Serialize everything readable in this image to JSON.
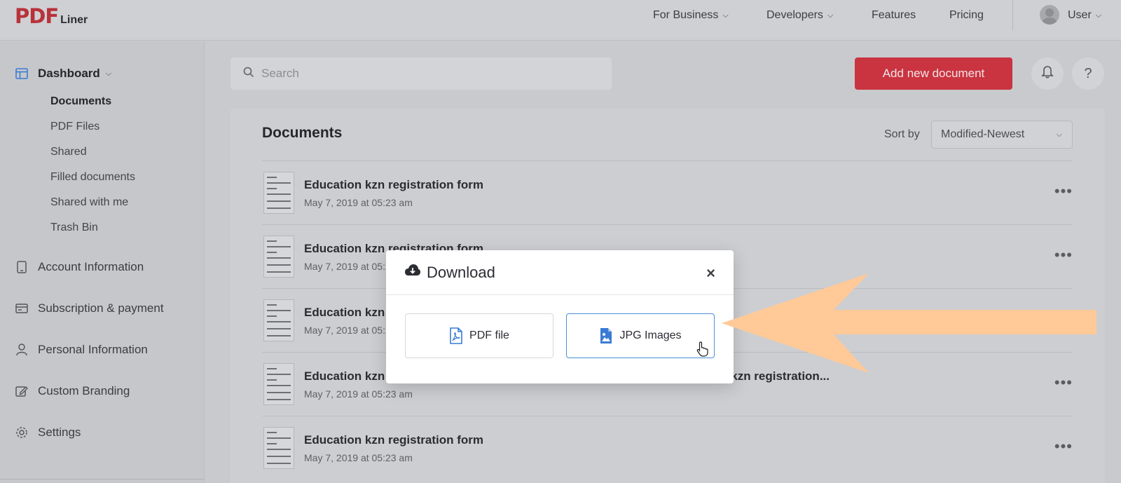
{
  "brand": {
    "logo_main": "PDF",
    "logo_sub": "Liner"
  },
  "topnav": {
    "for_business": "For Business",
    "developers": "Developers",
    "features": "Features",
    "pricing": "Pricing",
    "user": "User"
  },
  "sidebar": {
    "dashboard": "Dashboard",
    "sub_items": [
      "Documents",
      "PDF Files",
      "Shared",
      "Filled documents",
      "Shared with me",
      "Trash Bin"
    ],
    "account": "Account Information",
    "subscription": "Subscription & payment",
    "personal": "Personal Information",
    "branding": "Custom Branding",
    "settings": "Settings"
  },
  "search": {
    "placeholder": "Search"
  },
  "actions": {
    "add_document": "Add new document",
    "help": "?"
  },
  "documents": {
    "title": "Documents",
    "sort_label": "Sort by",
    "sort_value": "Modified-Newest",
    "rows": [
      {
        "title": "Education kzn registration form",
        "date": "May 7, 2019 at 05:23 am"
      },
      {
        "title": "Education kzn registration form",
        "date": "May 7, 2019 at 05:23 am"
      },
      {
        "title": "Education kzn registration form",
        "date": "May 7, 2019 at 05:23 am"
      },
      {
        "title": "Education kzn registration form education kzn registration form, education kzn registration...",
        "date": "May 7, 2019 at 05:23 am"
      },
      {
        "title": "Education kzn registration form",
        "date": "May 7, 2019 at 05:23 am"
      }
    ]
  },
  "modal": {
    "title": "Download",
    "close": "×",
    "option_pdf": "PDF file",
    "option_jpg": "JPG Images"
  },
  "colors": {
    "accent": "#c93440",
    "arrow": "#ffc998",
    "selected_border": "#4a90d9",
    "icon_blue": "#3a7bd5"
  }
}
